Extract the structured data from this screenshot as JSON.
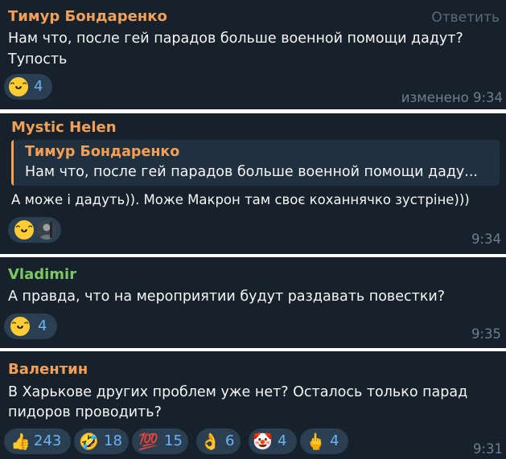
{
  "messages": [
    {
      "sender": "Тимур Бондаренко",
      "sender_color": "#f2a057",
      "reply_label": "Ответить",
      "lines": [
        "Нам что, после гей парадов больше военной помощи дадут?",
        "Тупость"
      ],
      "reactions": [
        {
          "emoji": "😁",
          "icon": "grinning-face-icon",
          "count": "4"
        }
      ],
      "time": "изменено 9:34"
    },
    {
      "sender": "Mystic Helen",
      "sender_color": "#f2a057",
      "quote": {
        "author": "Тимур Бондаренко",
        "text": "Нам что, после гей парадов больше военной помощи даду..."
      },
      "lines": [
        "А може і дадуть)). Може Макрон там своє коханнячко зустріне)))"
      ],
      "reactions": [
        {
          "emoji": "😁",
          "icon": "grinning-face-icon",
          "count": ""
        },
        {
          "emoji": "",
          "icon": "user-avatar-icon",
          "count": ""
        }
      ],
      "time": "9:34"
    },
    {
      "sender": "Vladimir",
      "sender_color": "#7bc862",
      "lines": [
        "А правда, что на мероприятии будут раздавать повестки?"
      ],
      "reactions": [
        {
          "emoji": "😁",
          "icon": "grinning-face-icon",
          "count": "4"
        }
      ],
      "time": "9:35"
    },
    {
      "sender": "Валентин",
      "sender_color": "#f2a057",
      "lines": [
        "В Харькове других проблем уже нет? Осталось только парад",
        "пидоров проводить?"
      ],
      "reactions": [
        {
          "emoji": "👍",
          "icon": "thumbs-up-icon",
          "count": "243"
        },
        {
          "emoji": "🤣",
          "icon": "rofl-face-icon",
          "count": "18"
        },
        {
          "emoji": "💯",
          "icon": "hundred-points-icon",
          "count": "15"
        },
        {
          "emoji": "👌",
          "icon": "ok-hand-icon",
          "count": "6"
        },
        {
          "emoji": "🤡",
          "icon": "clown-face-icon",
          "count": "4"
        },
        {
          "emoji": "🖕",
          "icon": "middle-finger-icon",
          "count": "4"
        }
      ],
      "time": "9:31"
    }
  ],
  "colors": {
    "bubble_bg": "#17212b",
    "separator": "#ffffff",
    "reaction_bg": "#2b3f52",
    "reaction_count": "#6ab3f3",
    "time_text": "#6d7f8f"
  }
}
